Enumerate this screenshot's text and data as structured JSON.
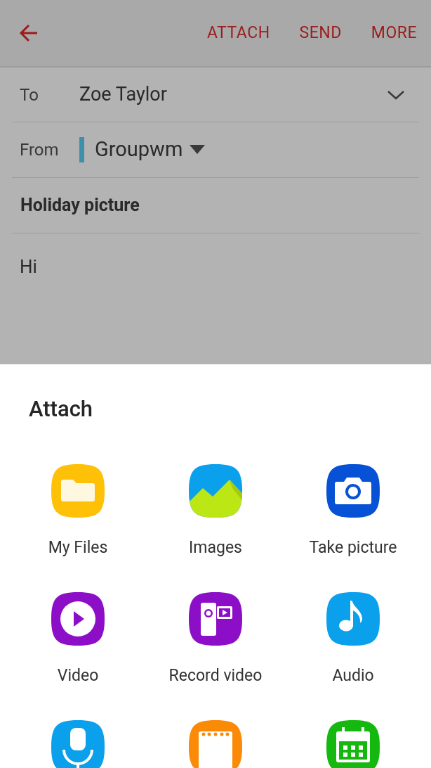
{
  "toolbar": {
    "actions": [
      "ATTACH",
      "SEND",
      "MORE"
    ]
  },
  "compose": {
    "to_label": "To",
    "to_value": "Zoe Taylor",
    "from_label": "From",
    "from_value": "Groupwm",
    "subject": "Holiday picture",
    "body": "Hi"
  },
  "attach_sheet": {
    "title": "Attach",
    "items": [
      {
        "kind": "files",
        "label": "My Files"
      },
      {
        "kind": "images",
        "label": "Images"
      },
      {
        "kind": "camera",
        "label": "Take picture"
      },
      {
        "kind": "video",
        "label": "Video"
      },
      {
        "kind": "record",
        "label": "Record video"
      },
      {
        "kind": "audio",
        "label": "Audio"
      },
      {
        "kind": "voice"
      },
      {
        "kind": "memo"
      },
      {
        "kind": "calendar"
      }
    ]
  }
}
